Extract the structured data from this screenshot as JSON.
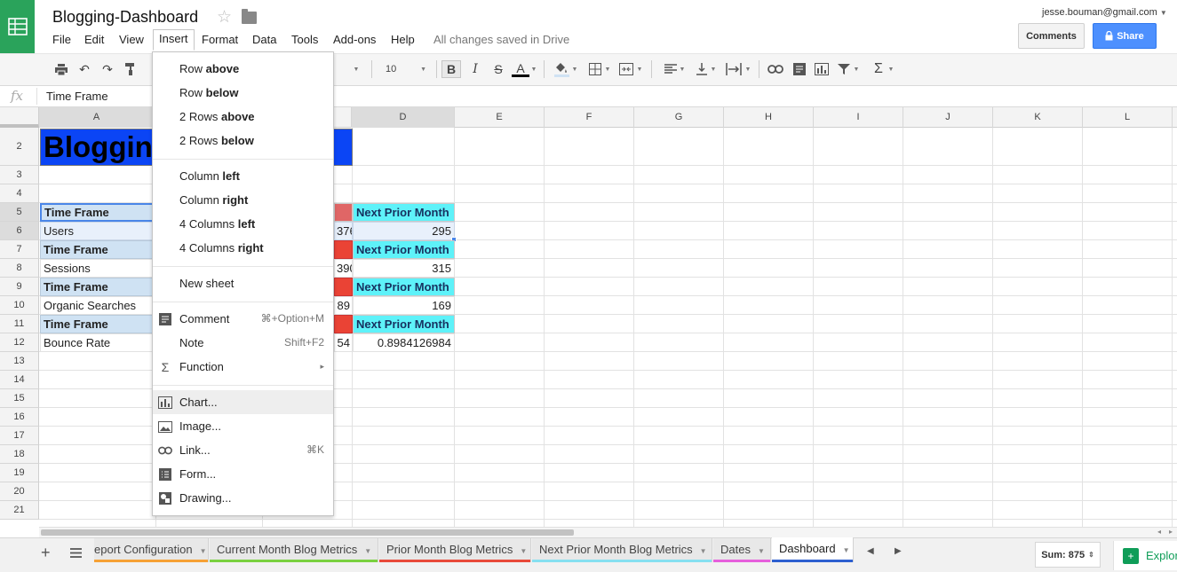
{
  "app": {
    "title": "Blogging-Dashboard",
    "saved_status": "All changes saved in Drive",
    "user_email": "jesse.bouman@gmail.com",
    "comments_label": "Comments",
    "share_label": "Share"
  },
  "menubar": [
    "File",
    "Edit",
    "View",
    "Insert",
    "Format",
    "Data",
    "Tools",
    "Add-ons",
    "Help"
  ],
  "toolbar": {
    "font_size": "10",
    "bold": "B",
    "italic": "I",
    "strike": "S",
    "text_color": "A",
    "sigma": "Σ"
  },
  "formula_bar": {
    "fx": "fx",
    "value": "Time Frame"
  },
  "columns": [
    "A",
    "D",
    "E",
    "F",
    "G",
    "H",
    "I",
    "J",
    "K",
    "L"
  ],
  "rows": [
    "2",
    "3",
    "4",
    "5",
    "6",
    "7",
    "8",
    "9",
    "10",
    "11",
    "12",
    "13",
    "14",
    "15",
    "16",
    "17",
    "18",
    "19",
    "20",
    "21"
  ],
  "grid": {
    "banner": "Blogging",
    "cells": {
      "a5": "Time Frame",
      "a6": "Users",
      "a7": "Time Frame",
      "a8": "Sessions",
      "a9": "Time Frame",
      "a10": "Organic Searches",
      "a11": "Time Frame",
      "a12": "Bounce Rate",
      "b6": "376",
      "b8": "390",
      "b10": "89",
      "b12": "54",
      "d5": "Next Prior Month",
      "d6": "295",
      "d7": "Next Prior Month",
      "d8": "315",
      "d9": "Next Prior Month",
      "d10": "169",
      "d11": "Next Prior Month",
      "d12": "0.8984126984"
    }
  },
  "insert_menu": {
    "row_above": [
      "Row ",
      "above"
    ],
    "row_below": [
      "Row ",
      "below"
    ],
    "rows_above": [
      "2 Rows ",
      "above"
    ],
    "rows_below": [
      "2 Rows ",
      "below"
    ],
    "col_left": [
      "Column ",
      "left"
    ],
    "col_right": [
      "Column ",
      "right"
    ],
    "cols_left": [
      "4 Columns ",
      "left"
    ],
    "cols_right": [
      "4 Columns ",
      "right"
    ],
    "new_sheet": "New sheet",
    "comment": "Comment",
    "comment_sc": "⌘+Option+M",
    "note": "Note",
    "note_sc": "Shift+F2",
    "function": "Function",
    "function_arrow": "▸",
    "chart": "Chart...",
    "image": "Image...",
    "link": "Link...",
    "link_sc": "⌘K",
    "form": "Form...",
    "drawing": "Drawing..."
  },
  "sheet_tabs": [
    {
      "label": "eport Configuration",
      "color": "#f6a135"
    },
    {
      "label": "Current Month Blog Metrics",
      "color": "#7ad140"
    },
    {
      "label": "Prior Month Blog Metrics",
      "color": "#e84a3a"
    },
    {
      "label": "Next Prior Month Blog Metrics",
      "color": "#86e0f0"
    },
    {
      "label": "Dates",
      "color": "#e65fdc"
    },
    {
      "label": "Dashboard",
      "color": "#2d5fd0"
    }
  ],
  "status": {
    "sum": "Sum: 875",
    "explore": "Explore"
  },
  "colors": {
    "header_fill": "#cfe2f3",
    "red_fill": "#ea4335",
    "cyan_fill": "#5ef2f9",
    "banner_fill": "#0b45f5",
    "brand_green": "#2aa35b"
  }
}
